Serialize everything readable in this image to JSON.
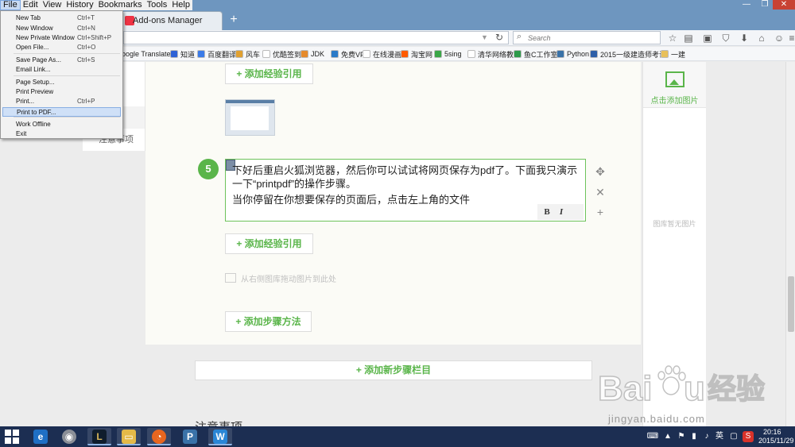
{
  "window": {
    "tab_title": "Add-ons Manager",
    "min_glyph": "—",
    "max_glyph": "❐",
    "close_glyph": "✕"
  },
  "menubar": [
    "File",
    "Edit",
    "View",
    "History",
    "Bookmarks",
    "Tools",
    "Help"
  ],
  "file_menu": {
    "items": [
      {
        "label": "New Tab",
        "shortcut": "Ctrl+T"
      },
      {
        "label": "New Window",
        "shortcut": "Ctrl+N"
      },
      {
        "label": "New Private Window",
        "shortcut": "Ctrl+Shift+P"
      },
      {
        "label": "Open File...",
        "shortcut": "Ctrl+O"
      },
      {
        "label": "Save Page As...",
        "shortcut": "Ctrl+S"
      },
      {
        "label": "Email Link...",
        "shortcut": ""
      },
      {
        "label": "Page Setup...",
        "shortcut": ""
      },
      {
        "label": "Print Preview",
        "shortcut": ""
      },
      {
        "label": "Print...",
        "shortcut": "Ctrl+P"
      },
      {
        "label": "Print to PDF...",
        "shortcut": "",
        "highlighted": true
      },
      {
        "label": "Work Offline",
        "shortcut": ""
      },
      {
        "label": "Exit",
        "shortcut": ""
      }
    ]
  },
  "navbar": {
    "search_placeholder": "Search"
  },
  "bookmarks": [
    {
      "label": "oogle Translate",
      "color": "#ffffff"
    },
    {
      "label": "知道",
      "color": "#2f62d6"
    },
    {
      "label": "百度翻译",
      "color": "#3b7be8"
    },
    {
      "label": "风车",
      "color": "#e0a030"
    },
    {
      "label": "优酷签到",
      "color": "#ffffff"
    },
    {
      "label": "JDK",
      "color": "#e58a2c"
    },
    {
      "label": "免费VPN",
      "color": "#2a7ac8"
    },
    {
      "label": "在线漫画",
      "color": "#ffffff"
    },
    {
      "label": "淘宝网",
      "color": "#ff5a00"
    },
    {
      "label": "5sing",
      "color": "#3aa648"
    },
    {
      "label": "清华网络教学",
      "color": "#ffffff"
    },
    {
      "label": "鱼C工作室",
      "color": "#2e9a4a"
    },
    {
      "label": "Python",
      "color": "#3a72a8"
    },
    {
      "label": "2015一级建造师考试",
      "color": "#2e5fa8"
    },
    {
      "label": "一建",
      "color": "#e8c05a"
    }
  ],
  "left_nav": [
    "料",
    "骤",
    "注意事项"
  ],
  "editor": {
    "add_reference": "+ 添加经验引用",
    "step_number": "5",
    "step_text_1": "下好后重启火狐浏览器，然后你可以试试将网页保存为pdf了。下面我只演示一下“printpdf”的操作步骤。",
    "step_text_2": "当你停留在你想要保存的页面后，点击左上角的文件",
    "bold_label": "B",
    "italic_label": "I",
    "drag_hint": "从右侧图库拖动图片到此处",
    "add_method": "+ 添加步骤方法",
    "add_section": "+ 添加新步骤栏目",
    "notes_heading": "注意事项"
  },
  "right_panel": {
    "add_image_label": "点击添加图片",
    "no_image_label": "图库暂无图片"
  },
  "watermark": {
    "logo": "Baidu经验",
    "url": "jingyan.baidu.com"
  },
  "taskbar": {
    "tray_lang": "英",
    "clock_time": "20:16",
    "clock_date": "2015/11/29"
  },
  "colors": {
    "accent_green": "#5ab54a",
    "titlebar_blue": "#6e96bf",
    "taskbar": "#1c2e52"
  }
}
